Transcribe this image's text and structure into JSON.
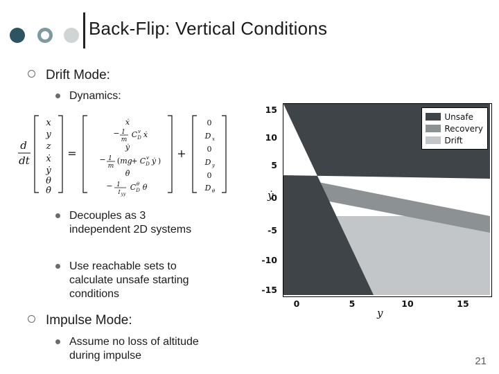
{
  "slide": {
    "title": "Back-Flip: Vertical Conditions",
    "page_number": "21"
  },
  "bullets": {
    "drift_mode": "Drift Mode:",
    "dynamics": "Dynamics:",
    "decouples": "Decouples as 3 independent 2D systems",
    "reachable": "Use reachable sets to calculate unsafe starting conditions",
    "impulse_mode": "Impulse Mode:",
    "assume": "Assume no loss of altitude during impulse"
  },
  "equation": {
    "lhs_operator": "d/dt",
    "state_vector": [
      "x",
      "y",
      "z",
      "ẋ",
      "ẏ",
      "θ",
      "θ̇"
    ],
    "equals": "=",
    "dynamics_terms": [
      "ẋ",
      "-1/m C_D^v ẋ",
      "ẏ",
      "-1/m (mg + C_D^v ẏ)",
      "θ̇",
      "-1/I_yy C_D^θ θ̇"
    ],
    "plus": "+",
    "input_vector": [
      "0",
      "D_x",
      "0",
      "D_y",
      "0",
      "D_θ"
    ]
  },
  "chart_data": {
    "type": "area",
    "title": "",
    "xlabel": "y",
    "ylabel": "ẏ",
    "xlim": [
      -2.2,
      18.5
    ],
    "ylim": [
      -17.0,
      16.8
    ],
    "xticks": [
      "0",
      "5",
      "10",
      "15"
    ],
    "xtick_values": [
      0,
      5,
      10,
      15
    ],
    "yticks": [
      "15",
      "10",
      "5",
      "0",
      "-5",
      "-10",
      "-15"
    ],
    "ytick_values": [
      15,
      10,
      5,
      0,
      -5,
      -10,
      -15
    ],
    "grid": false,
    "legend_position": "top-right",
    "series": [
      {
        "name": "Unsafe",
        "color": "#3f4448",
        "description": "Dark wedge filling left portion, bounded by a line descending from (0,5) to about (9,-17)"
      },
      {
        "name": "Recovery",
        "color": "#8c9194",
        "description": "Mid-gray band from (0,5) sloping down to the right edge near (18.5,-3)"
      },
      {
        "name": "Drift",
        "color": "#c2c6c8",
        "description": "Light gray region below the Recovery band extending to the lower right"
      }
    ]
  },
  "colors": {
    "unsafe": "#3f4448",
    "recovery": "#8c9194",
    "drift": "#c2c6c8",
    "accent_dark": "#2c5461",
    "accent_mid": "#7d9aa3",
    "accent_light": "#cfd4d4"
  }
}
